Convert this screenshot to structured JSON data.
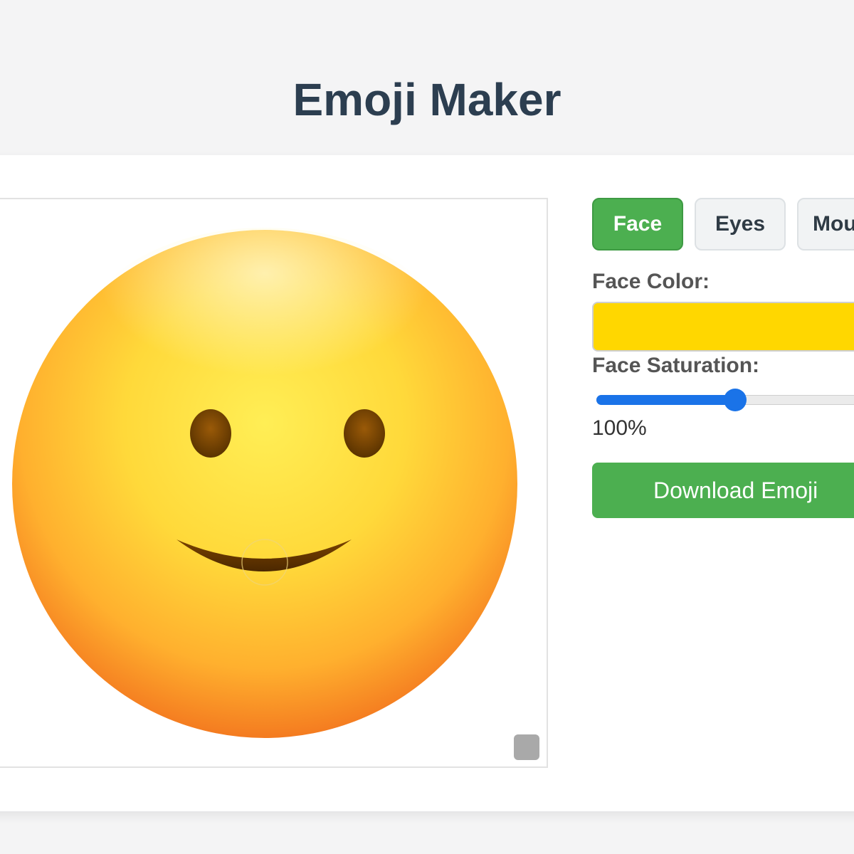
{
  "header": {
    "title": "Emoji Maker"
  },
  "tabs": [
    {
      "label": "Face",
      "active": true
    },
    {
      "label": "Eyes",
      "active": false
    },
    {
      "label": "Mou",
      "active": false
    }
  ],
  "controls": {
    "face_color_label": "Face Color:",
    "face_color_value": "#ffd700",
    "face_saturation_label": "Face Saturation:",
    "face_saturation_percent": 100,
    "face_saturation_display": "100%",
    "download_label": "Download Emoji"
  },
  "colors": {
    "accent_green": "#4caf50",
    "slider_blue": "#1a73e8",
    "title_color": "#2c3e50"
  },
  "icons": {
    "preview": "smiling-face-emoji",
    "canvas_handle": "resize-handle-icon"
  }
}
